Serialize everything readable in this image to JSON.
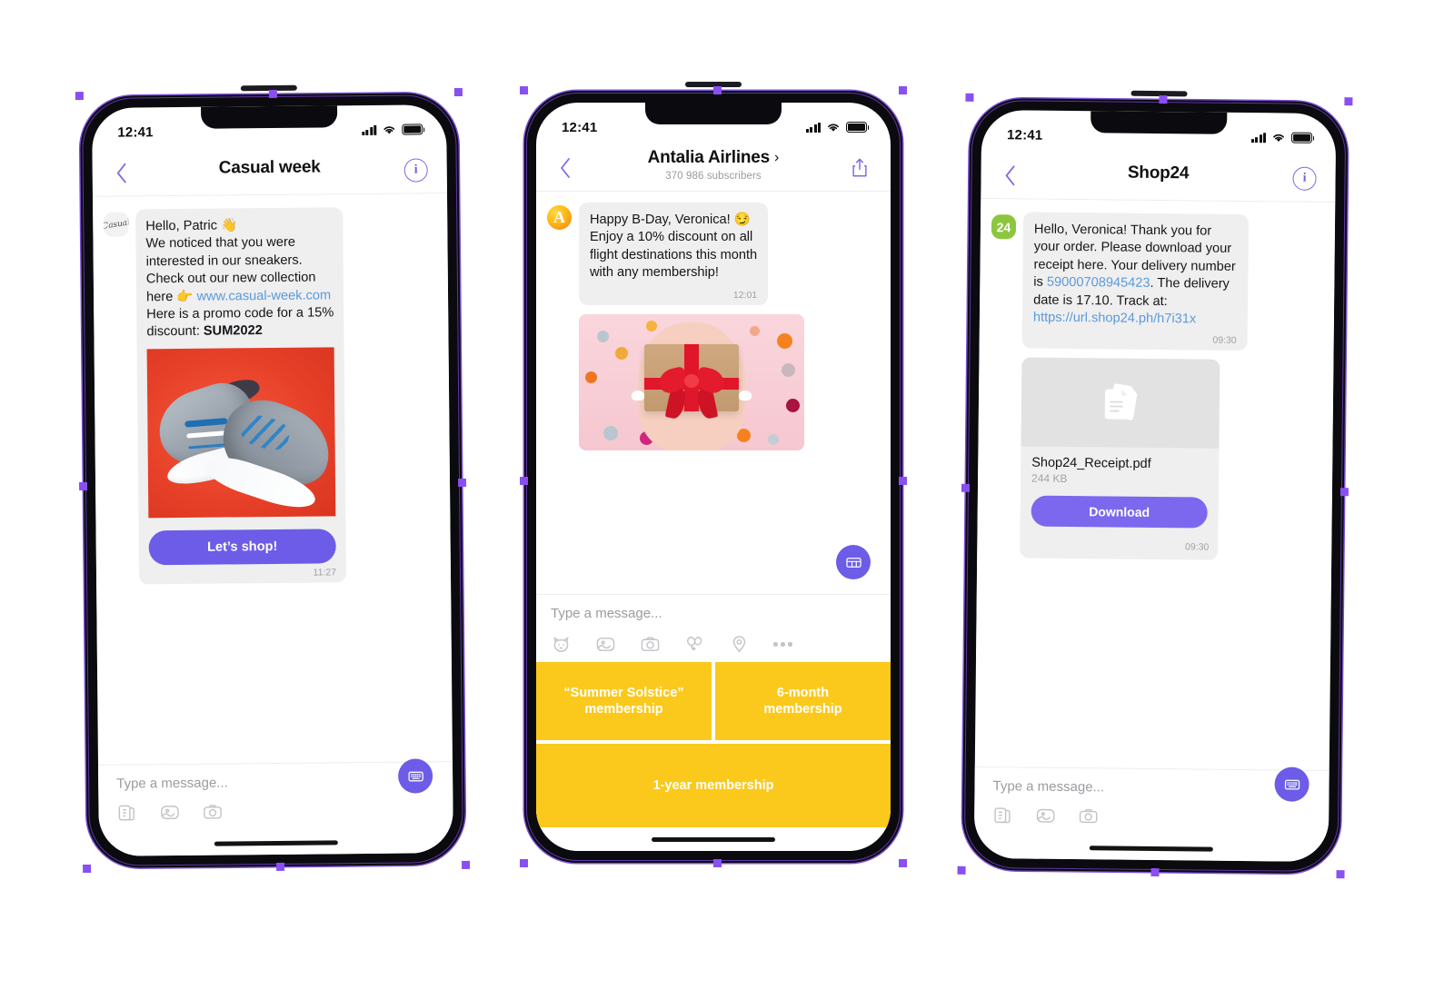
{
  "meta": {
    "accent_purple": "#6c5ce7",
    "yellow": "#fbc91b",
    "link_blue": "#5b9ad9",
    "bubble_gray": "#efefef",
    "handle_purple": "#8a4ff0"
  },
  "phones": [
    {
      "id": "casual-week",
      "status": {
        "time": "12:41",
        "signal_icon": "cellular-bars-icon",
        "wifi_icon": "wifi-icon",
        "battery_icon": "battery-icon"
      },
      "nav": {
        "back_icon": "back-chevron-icon",
        "title": "Casual week",
        "subtitle": "",
        "right_icon": "info-icon",
        "right_glyph": "i"
      },
      "message": {
        "avatar_name": "casual-week-avatar",
        "avatar_text": "Casual",
        "lines": [
          {
            "text": "Hello, Patric ",
            "emoji": "👋"
          },
          {
            "text": "We noticed that you were"
          },
          {
            "text": "interested in our sneakers."
          },
          {
            "text": "Check out our new collection"
          }
        ],
        "link_line_prefix": "here ",
        "link_emoji": "👉",
        "link_text": "www.casual-week.com",
        "promo_line": "Here is a promo code for a 15%",
        "promo_prefix": "discount: ",
        "promo_code": "SUM2022",
        "image_name": "sneakers-promo-image",
        "cta_label": "Let’s shop!",
        "time": "11:27"
      },
      "composer": {
        "placeholder": "Type a message...",
        "tools": [
          "sticker-pack-icon",
          "image-icon",
          "camera-icon"
        ],
        "keyboard_button": "keyboard-icon"
      }
    },
    {
      "id": "antalia-airlines",
      "status": {
        "time": "12:41",
        "signal_icon": "cellular-bars-icon",
        "wifi_icon": "wifi-icon",
        "battery_icon": "battery-icon"
      },
      "nav": {
        "back_icon": "back-chevron-icon",
        "title": "Antalia Airlines",
        "title_chevron": "›",
        "subtitle": "370 986 subscribers",
        "right_icon": "share-icon"
      },
      "message": {
        "avatar_name": "antalia-airlines-avatar",
        "avatar_text": "A",
        "lines": [
          {
            "text": "Happy B-Day, Veronica! ",
            "emoji": "😏"
          },
          {
            "text": "Enjoy a 10% discount on all"
          },
          {
            "text": "flight destinations this month"
          },
          {
            "text": "with any membership!"
          }
        ],
        "time": "12:01",
        "image_name": "gift-box-image"
      },
      "composer": {
        "placeholder": "Type a message...",
        "tools": [
          "sticker-cat-icon",
          "image-icon",
          "camera-icon",
          "gift-balloon-icon",
          "location-pin-icon",
          "more-dots-icon"
        ],
        "keyboard_button": "keyboard-icon"
      },
      "keyboard_menu": {
        "rows": [
          [
            "“Summer Solstice”\nmembership",
            "6-month\nmembership"
          ],
          [
            "1-year membership"
          ]
        ],
        "buttons": [
          {
            "line1": "“Summer Solstice”",
            "line2": "membership"
          },
          {
            "line1": "6-month",
            "line2": "membership"
          },
          {
            "line1": "1-year membership",
            "line2": ""
          }
        ]
      }
    },
    {
      "id": "shop24",
      "status": {
        "time": "12:41",
        "signal_icon": "cellular-bars-icon",
        "wifi_icon": "wifi-icon",
        "battery_icon": "battery-icon"
      },
      "nav": {
        "back_icon": "back-chevron-icon",
        "title": "Shop24",
        "subtitle": "",
        "right_icon": "info-icon",
        "right_glyph": "i"
      },
      "message": {
        "avatar_name": "shop24-avatar",
        "avatar_text": "24",
        "body_part1": "Hello, Veronica! Thank you for your order. Please download your receipt here. Your delivery number is ",
        "tracking_number": "59000708945423",
        "body_part2": ". The delivery date is 17.10. Track at: ",
        "tracking_url": "https://url.shop24.ph/h7i31x",
        "time": "09:30"
      },
      "file": {
        "preview_icon": "document-stack-icon",
        "name": "Shop24_Receipt.pdf",
        "size": "244 KB",
        "download_label": "Download",
        "time": "09:30"
      },
      "composer": {
        "placeholder": "Type a message...",
        "tools": [
          "sticker-pack-icon",
          "image-icon",
          "camera-icon"
        ],
        "keyboard_button": "keyboard-icon"
      }
    }
  ]
}
